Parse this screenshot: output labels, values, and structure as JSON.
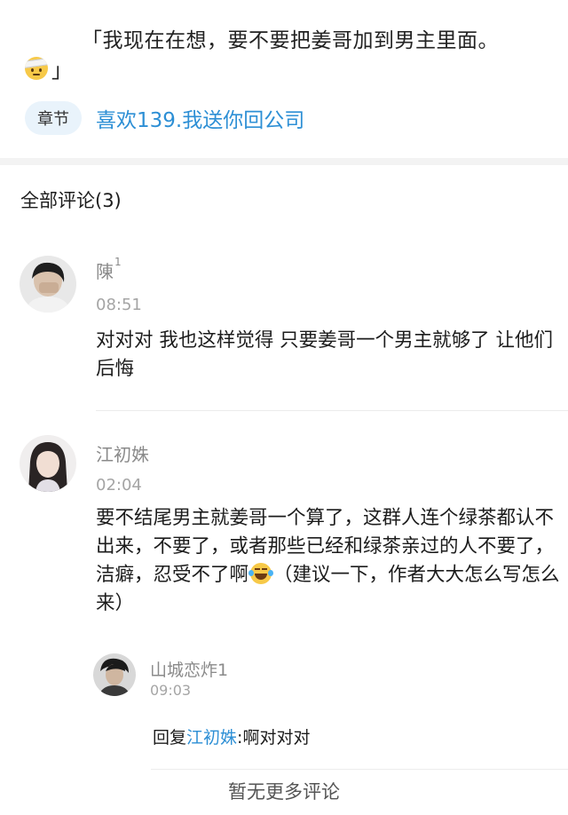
{
  "quote": {
    "line1": "「我现在在想，要不要把姜哥加到男主里面。",
    "line2_tail": "」",
    "emoji_icon": "bandaged-face-emoji"
  },
  "chapter": {
    "tag_label": "章节",
    "link_text": "喜欢139.我送你回公司"
  },
  "comments_header": {
    "title": "全部评论(3)"
  },
  "comments": [
    {
      "username": "陳",
      "superscript": "1",
      "time": "08:51",
      "text": "对对对 我也这样觉得 只要姜哥一个男主就够了 让他们后悔"
    },
    {
      "username": "江初姝",
      "time": "02:04",
      "text_part1": "要不结尾男主就姜哥一个算了，这群人连个绿茶都认不出来，不要了，或者那些已经和绿茶亲过的人不要了，洁癖，忍受不了啊",
      "text_emoji": "laughing-tears-emoji",
      "text_part2": "（建议一下，作者大大怎么写怎么来）",
      "reply": {
        "username": "山城恋炸1",
        "time": "09:03",
        "prefix": "回复",
        "reply_to": "江初姝",
        "separator": ":",
        "text": "啊对对对"
      }
    }
  ],
  "footer": {
    "no_more": "暂无更多评论"
  },
  "colors": {
    "link": "#2d8fd5",
    "tag_bg": "#e9f3fb",
    "muted": "#8a8a8a"
  }
}
